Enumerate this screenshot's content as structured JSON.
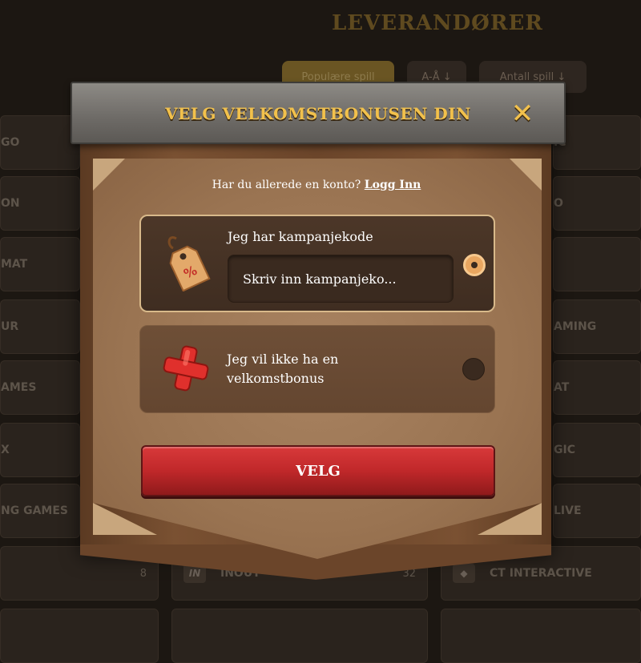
{
  "page": {
    "title": "LEVERANDØRER",
    "sort_buttons": [
      "Populære spill",
      "A-Å ↓",
      "Antall spill ↓"
    ]
  },
  "providers_left": [
    "GO",
    "ON",
    "MAT",
    "UR",
    "AMES",
    "X",
    "NG GAMES",
    "",
    ""
  ],
  "providers_right": [
    "IC",
    "O",
    "",
    "AMING",
    "AT",
    "GIC",
    "LIVE",
    "CT INTERACTIVE",
    ""
  ],
  "bottom_row": {
    "left_count": "8",
    "middle": {
      "icon_text": "IN",
      "name": "INOUT",
      "count": "32"
    }
  },
  "modal": {
    "title": "VELG VELKOMSTBONUSEN DIN",
    "close_glyph": "✕",
    "login_prompt": "Har du allerede en konto?",
    "login_link": "Logg Inn",
    "option_promo": {
      "label": "Jeg har kampanjekode",
      "input_placeholder": "Skriv inn kampanjekode",
      "input_display": "Skriv inn kampanjeko...",
      "selected": true,
      "icon": "price-tag-icon"
    },
    "option_none": {
      "label_line1": "Jeg vil ikke ha en",
      "label_line2": "velkomstbonus",
      "selected": false,
      "icon": "red-cross-icon"
    },
    "submit_label": "VELG"
  },
  "colors": {
    "accent_gold": "#f2c14c",
    "button_red": "#c0282a",
    "radio_orange": "#e9a660"
  }
}
